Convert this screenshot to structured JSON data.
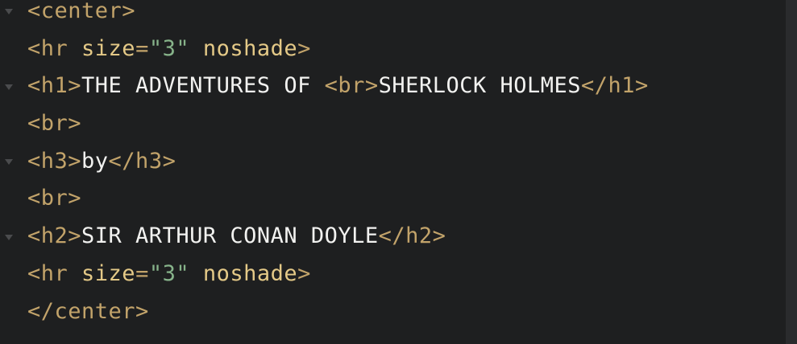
{
  "editor": {
    "colors": {
      "background": "#1e1f20",
      "tag": "#c2a36a",
      "attribute": "#e4c987",
      "string": "#87b38a",
      "text": "#f2f2f0",
      "fold_marker": "#4a4b4d"
    },
    "fold_lines": [
      0,
      2,
      4,
      6
    ],
    "lines": [
      {
        "tokens": [
          {
            "t": "tag",
            "v": "<center>"
          }
        ]
      },
      {
        "tokens": [
          {
            "t": "tag",
            "v": "<hr "
          },
          {
            "t": "attr",
            "v": "size"
          },
          {
            "t": "tag",
            "v": "="
          },
          {
            "t": "str",
            "v": "\"3\""
          },
          {
            "t": "tag",
            "v": " "
          },
          {
            "t": "attr",
            "v": "noshade"
          },
          {
            "t": "tag",
            "v": ">"
          }
        ]
      },
      {
        "tokens": [
          {
            "t": "tag",
            "v": "<h1>"
          },
          {
            "t": "txt",
            "v": "THE ADVENTURES OF "
          },
          {
            "t": "tag",
            "v": "<br>"
          },
          {
            "t": "txt",
            "v": "SHERLOCK HOLMES"
          },
          {
            "t": "tag",
            "v": "</h1>"
          }
        ]
      },
      {
        "tokens": [
          {
            "t": "tag",
            "v": "<br>"
          }
        ]
      },
      {
        "tokens": [
          {
            "t": "tag",
            "v": "<h3>"
          },
          {
            "t": "txt",
            "v": "by"
          },
          {
            "t": "tag",
            "v": "</h3>"
          }
        ]
      },
      {
        "tokens": [
          {
            "t": "tag",
            "v": "<br>"
          }
        ]
      },
      {
        "tokens": [
          {
            "t": "tag",
            "v": "<h2>"
          },
          {
            "t": "txt",
            "v": "SIR ARTHUR CONAN DOYLE"
          },
          {
            "t": "tag",
            "v": "</h2>"
          }
        ]
      },
      {
        "tokens": [
          {
            "t": "tag",
            "v": "<hr "
          },
          {
            "t": "attr",
            "v": "size"
          },
          {
            "t": "tag",
            "v": "="
          },
          {
            "t": "str",
            "v": "\"3\""
          },
          {
            "t": "tag",
            "v": " "
          },
          {
            "t": "attr",
            "v": "noshade"
          },
          {
            "t": "tag",
            "v": ">"
          }
        ]
      },
      {
        "tokens": [
          {
            "t": "tag",
            "v": "</center>"
          }
        ]
      }
    ]
  }
}
